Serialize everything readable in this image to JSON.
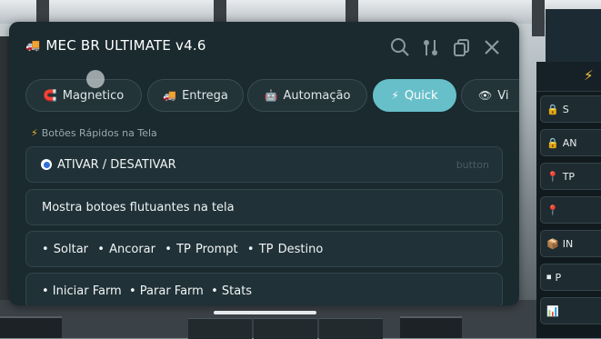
{
  "window": {
    "title": "MEC BR ULTIMATE v4.6",
    "title_icon": "truck-icon",
    "toolbar_icons": [
      "search-icon",
      "pin-tool-icon",
      "copy-icon",
      "close-icon"
    ]
  },
  "tabs": [
    {
      "label": "Magnetico",
      "icon": "magnet-icon",
      "active": false
    },
    {
      "label": "Entrega",
      "icon": "truck-icon",
      "active": false
    },
    {
      "label": "Automação",
      "icon": "robot-icon",
      "active": false
    },
    {
      "label": "Quick",
      "icon": "bolt-icon",
      "active": true
    },
    {
      "label": "Vi",
      "icon": "eye-icon",
      "active": false
    }
  ],
  "section": {
    "icon": "bolt-icon",
    "label": "Botões Rápidos na Tela"
  },
  "cards": {
    "toggle_label": "ATIVAR / DESATIVAR",
    "toggle_hint": "button",
    "description": "Mostra botoes flutuantes na tela",
    "row1": [
      "• Soltar",
      "• Ancorar",
      "• TP Prompt",
      "• TP Destino"
    ],
    "row2": [
      "• Iniciar Farm",
      "• Parar Farm",
      "• Stats"
    ]
  },
  "side_panel": {
    "buttons": [
      {
        "label": "S",
        "icon": "lock-icon"
      },
      {
        "label": "AN",
        "icon": "lock-icon"
      },
      {
        "label": "TP",
        "icon": "pin-icon"
      },
      {
        "label": "",
        "icon": "pin-icon"
      },
      {
        "label": "IN",
        "icon": "box-icon"
      },
      {
        "label": "P",
        "icon": "stop-icon"
      },
      {
        "label": "",
        "icon": "chart-icon"
      }
    ]
  },
  "colors": {
    "window_bg": "#1a2a2f",
    "card_bg": "#203137",
    "active_tab": "#67bfc9",
    "accent_bolt": "#f5c542"
  }
}
